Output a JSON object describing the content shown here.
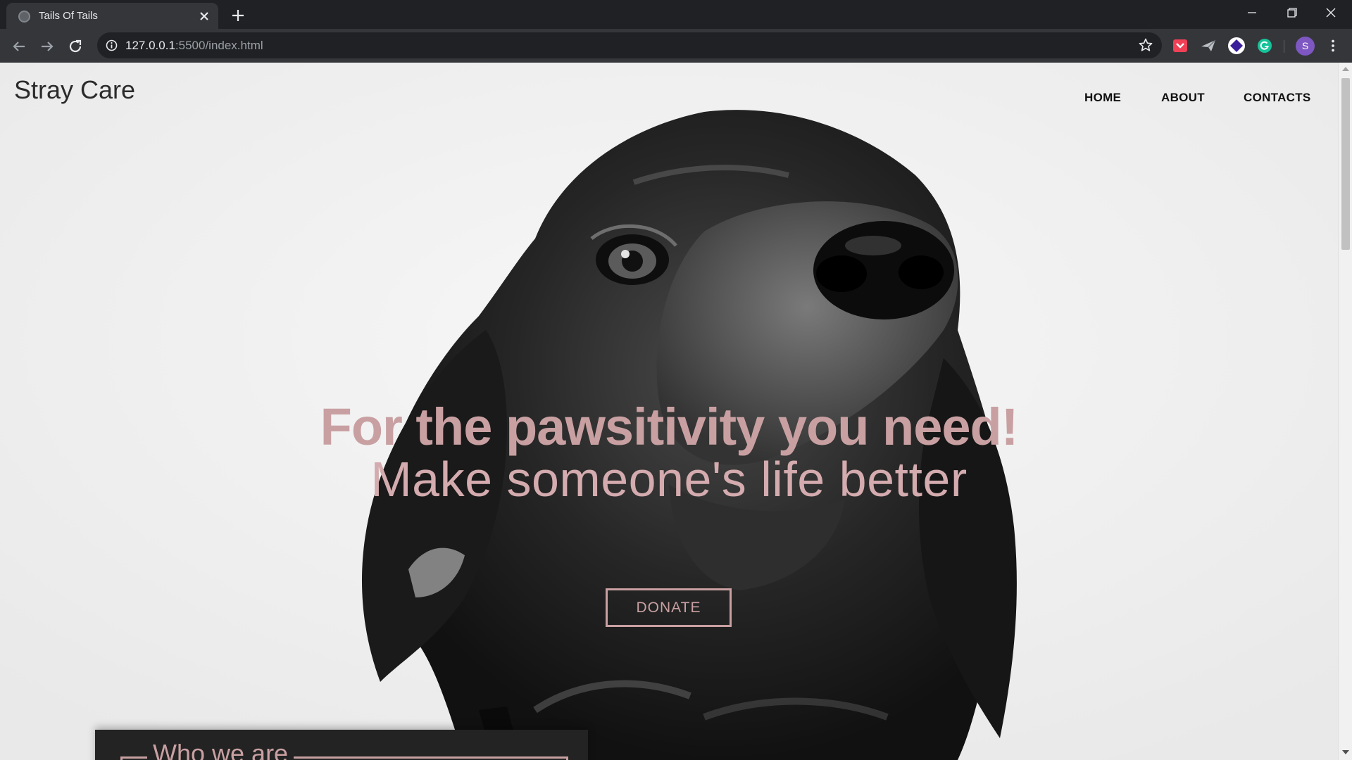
{
  "browser": {
    "tab": {
      "title": "Tails Of Tails",
      "favicon": "globe-icon"
    },
    "url": {
      "host": "127.0.0.1",
      "path": ":5500/index.html"
    },
    "avatar_letter": "S",
    "colors": {
      "frame": "#202124",
      "toolbar": "#35363a",
      "avatar": "#7e57c2"
    }
  },
  "site": {
    "brand": "Stray Care",
    "nav": {
      "home": "HOME",
      "about": "ABOUT",
      "contacts": "CONTACTS"
    },
    "hero": {
      "headline": "For the pawsitivity you need!",
      "subline": "Make someone's life better",
      "cta": "DONATE",
      "image": "black-dog-portrait"
    },
    "section": {
      "title": "Who we are"
    },
    "colors": {
      "accent": "#c9a0a2",
      "background": "#f2f2f2",
      "card": "#232323"
    }
  }
}
